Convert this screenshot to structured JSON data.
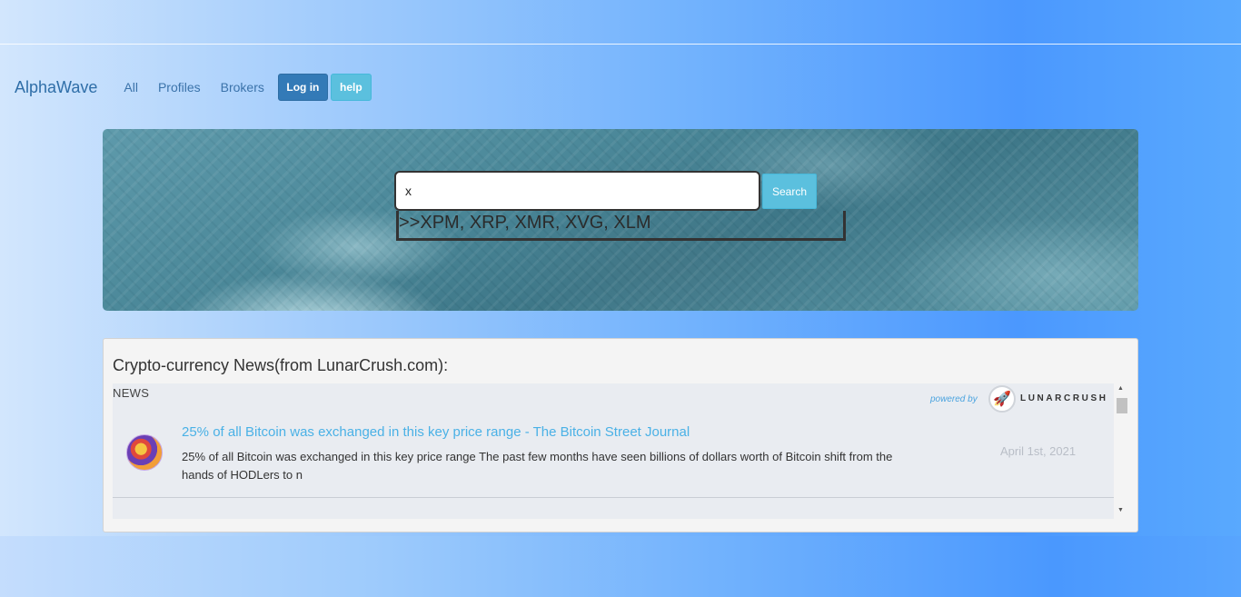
{
  "nav": {
    "brand": "AlphaWave",
    "links": [
      "All",
      "Profiles",
      "Brokers"
    ],
    "login_label": "Log in",
    "help_label": "help"
  },
  "search": {
    "value": "x",
    "button_label": "Search",
    "suggestions": ">>XPM, XRP, XMR, XVG, XLM"
  },
  "news": {
    "panel_title": "Crypto-currency News(from LunarCrush.com):",
    "section_label": "NEWS",
    "powered_by": "powered by",
    "brand": "LUNARCRUSH",
    "items": [
      {
        "title": "25% of all Bitcoin was exchanged in this key price range - The Bitcoin Street Journal",
        "description": "25% of all Bitcoin was exchanged in this key price range The past few months have seen billions of dollars worth of Bitcoin shift from the hands of HODLers to n",
        "date": "April 1st, 2021"
      }
    ]
  },
  "colors": {
    "primary_button": "#337ab7",
    "info_button": "#5bc0de",
    "news_link": "#4ab1e6"
  }
}
